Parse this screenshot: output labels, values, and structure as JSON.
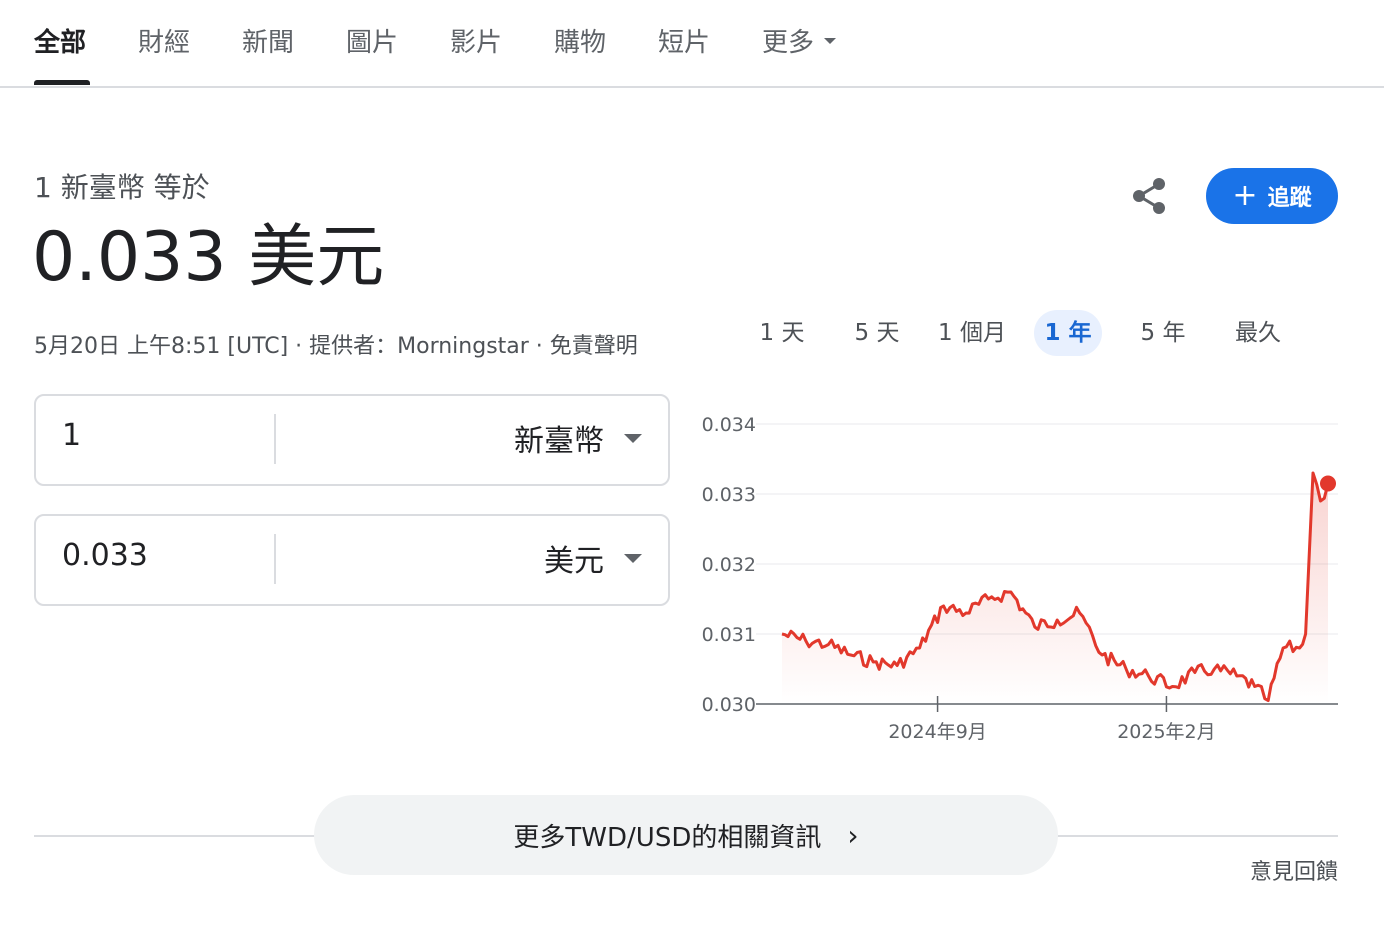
{
  "tabs": [
    {
      "label": "全部",
      "active": true
    },
    {
      "label": "財經",
      "active": false
    },
    {
      "label": "新聞",
      "active": false
    },
    {
      "label": "圖片",
      "active": false
    },
    {
      "label": "影片",
      "active": false
    },
    {
      "label": "購物",
      "active": false
    },
    {
      "label": "短片",
      "active": false
    },
    {
      "label": "更多",
      "active": false
    }
  ],
  "header": {
    "equals_text": "1 新臺幣 等於",
    "result_text": "0.033 美元",
    "meta_text": "5月20日 上午8:51 [UTC] · 提供者：Morningstar · 免責聲明",
    "follow_label": "追蹤",
    "follow_plus": "+",
    "share_icon": "share-icon"
  },
  "converter": {
    "from": {
      "value": "1",
      "currency": "新臺幣"
    },
    "to": {
      "value": "0.033",
      "currency": "美元"
    }
  },
  "ranges": [
    {
      "label": "1 天",
      "active": false
    },
    {
      "label": "5 天",
      "active": false
    },
    {
      "label": "1 個月",
      "active": false
    },
    {
      "label": "1 年",
      "active": true
    },
    {
      "label": "5 年",
      "active": false
    },
    {
      "label": "最久",
      "active": false
    }
  ],
  "colors": {
    "accent": "#1a73e8",
    "line": "#e2382c",
    "text": "#202124",
    "muted": "#4d5156"
  },
  "chart_data": {
    "type": "line",
    "title": "",
    "xlabel": "",
    "ylabel": "",
    "ylim": [
      0.03,
      0.034
    ],
    "yticks": [
      "0.034",
      "0.033",
      "0.032",
      "0.031",
      "0.030"
    ],
    "xticks": [
      "2024年9月",
      "2025年2月"
    ],
    "x": [
      "2024-05-20",
      "2024-06-05",
      "2024-06-20",
      "2024-07-05",
      "2024-07-20",
      "2024-08-05",
      "2024-08-20",
      "2024-09-05",
      "2024-09-20",
      "2024-10-05",
      "2024-10-20",
      "2024-11-05",
      "2024-11-20",
      "2024-12-05",
      "2024-12-20",
      "2025-01-05",
      "2025-01-20",
      "2025-02-05",
      "2025-02-20",
      "2025-03-05",
      "2025-03-20",
      "2025-04-01",
      "2025-04-10",
      "2025-04-20",
      "2025-05-01",
      "2025-05-05",
      "2025-05-10",
      "2025-05-15",
      "2025-05-20"
    ],
    "series": [
      {
        "values": [
          0.031,
          0.0309,
          0.03085,
          0.0307,
          0.0306,
          0.03055,
          0.0308,
          0.0314,
          0.0313,
          0.0315,
          0.0316,
          0.0311,
          0.0312,
          0.0313,
          0.0307,
          0.0305,
          0.0304,
          0.03025,
          0.03045,
          0.0305,
          0.0304,
          0.03025,
          0.03005,
          0.0308,
          0.0308,
          0.031,
          0.0333,
          0.0329,
          0.03315
        ]
      }
    ],
    "grid": true,
    "legend": "none"
  },
  "footer": {
    "more_label": "更多TWD/USD的相關資訊",
    "chevron": "›",
    "feedback_label": "意見回饋"
  }
}
